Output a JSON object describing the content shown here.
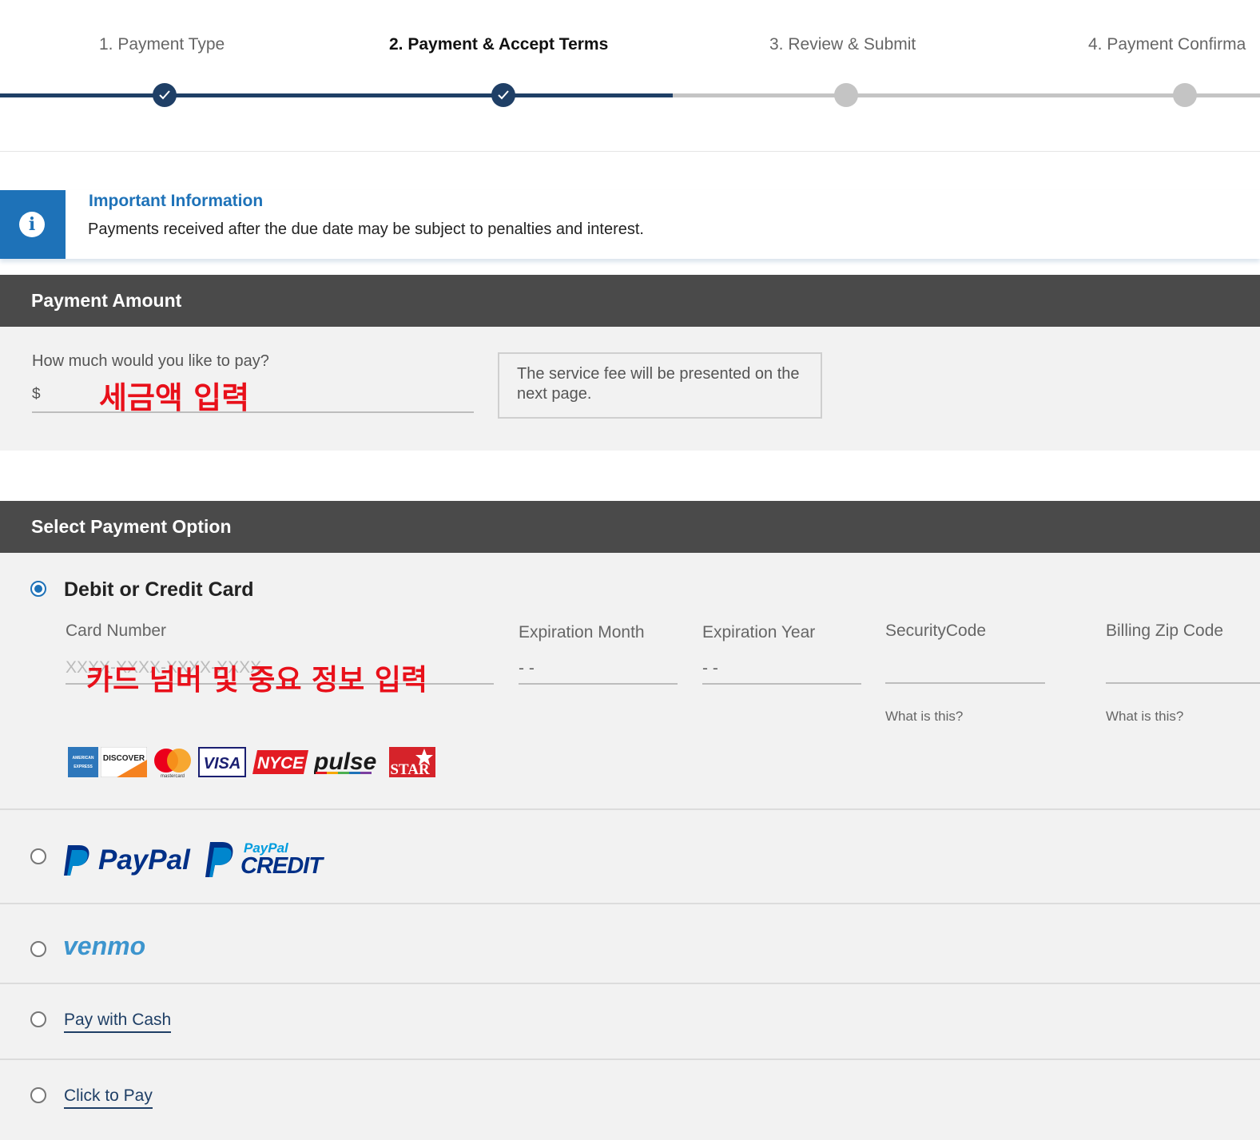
{
  "stepper": {
    "steps": [
      {
        "label": "1. Payment Type",
        "state": "done"
      },
      {
        "label": "2. Payment & Accept Terms",
        "state": "active"
      },
      {
        "label": "3. Review & Submit",
        "state": "todo"
      },
      {
        "label": "4. Payment Confirma",
        "state": "todo"
      }
    ]
  },
  "info": {
    "icon": "info-icon",
    "title": "Important Information",
    "text": "Payments received after the due date may be subject to penalties and interest."
  },
  "payment_amount": {
    "header": "Payment Amount",
    "question": "How much would you like to pay?",
    "currency": "$",
    "value": "",
    "overlay_note": "세금액 입력",
    "fee_note": "The service fee will be presented on the next page."
  },
  "payment_option": {
    "header": "Select Payment Option",
    "card": {
      "label": "Debit or Credit Card",
      "selected": true,
      "card_number_label": "Card Number",
      "card_number_placeholder": "XXXX-XXXX-XXXX-XXXX",
      "exp_month_label": "Expiration Month",
      "exp_month_value": "- -",
      "exp_year_label": "Expiration Year",
      "exp_year_value": "- -",
      "security_label": "SecurityCode",
      "security_help": "What is this?",
      "zip_label": "Billing Zip Code",
      "zip_help": "What is this?",
      "overlay_note": "카드 넘버 및 중요 정보 입력",
      "logos": {
        "amex": "AMERICAN EXPRESS",
        "discover": "DISCOVER",
        "mastercard": "mastercard",
        "visa": "VISA",
        "nyce": "NYCE",
        "pulse": "pulse",
        "star": "STAR"
      }
    },
    "paypal": {
      "label": "PayPal",
      "credit_top": "PayPal",
      "credit_bottom": "CREDIT"
    },
    "venmo": {
      "label": "venmo"
    },
    "cash": {
      "label": "Pay with Cash"
    },
    "click_to_pay": {
      "label": "Click to Pay"
    }
  },
  "colors": {
    "primary": "#1f3f66",
    "accent": "#1e72b8",
    "section_bar": "#4a4a4a",
    "overlay_red": "#e8101a"
  }
}
